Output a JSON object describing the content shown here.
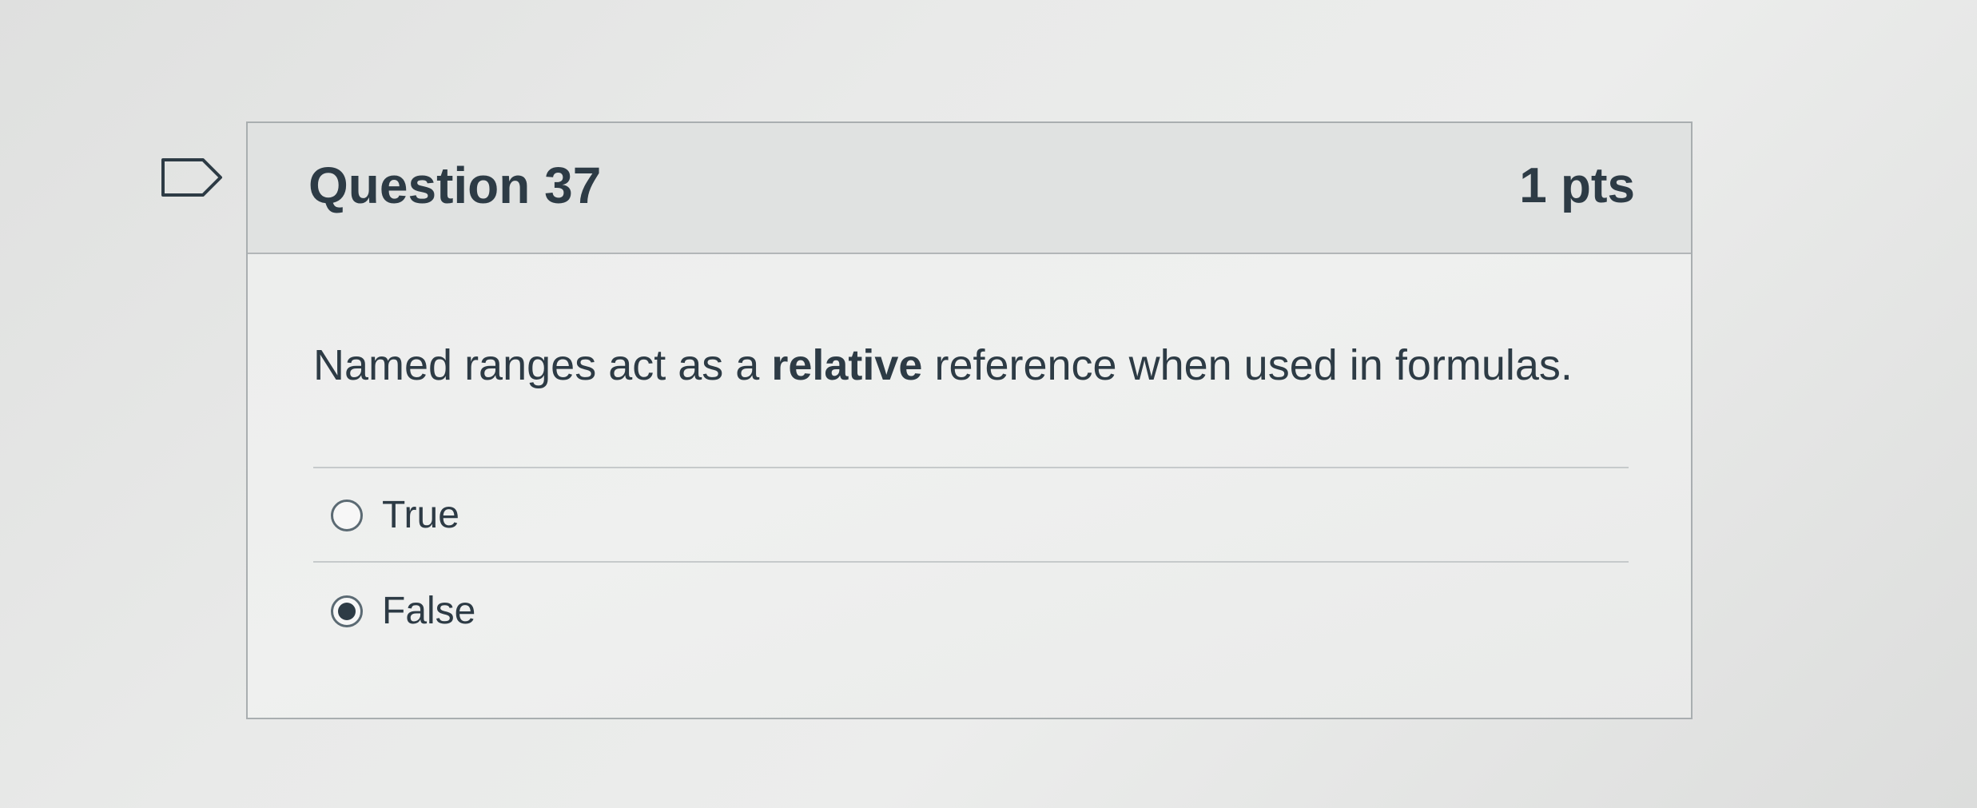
{
  "question": {
    "title": "Question 37",
    "points": "1 pts",
    "text_before": "Named ranges act as a ",
    "text_bold": "relative",
    "text_after": " reference when used in formulas.",
    "flag_icon": "flag-outline-icon"
  },
  "answers": [
    {
      "label": "True",
      "selected": false
    },
    {
      "label": "False",
      "selected": true
    }
  ],
  "colors": {
    "text": "#2d3b45",
    "header_bg": "#e0e2e1",
    "border": "#a9aeb0"
  }
}
